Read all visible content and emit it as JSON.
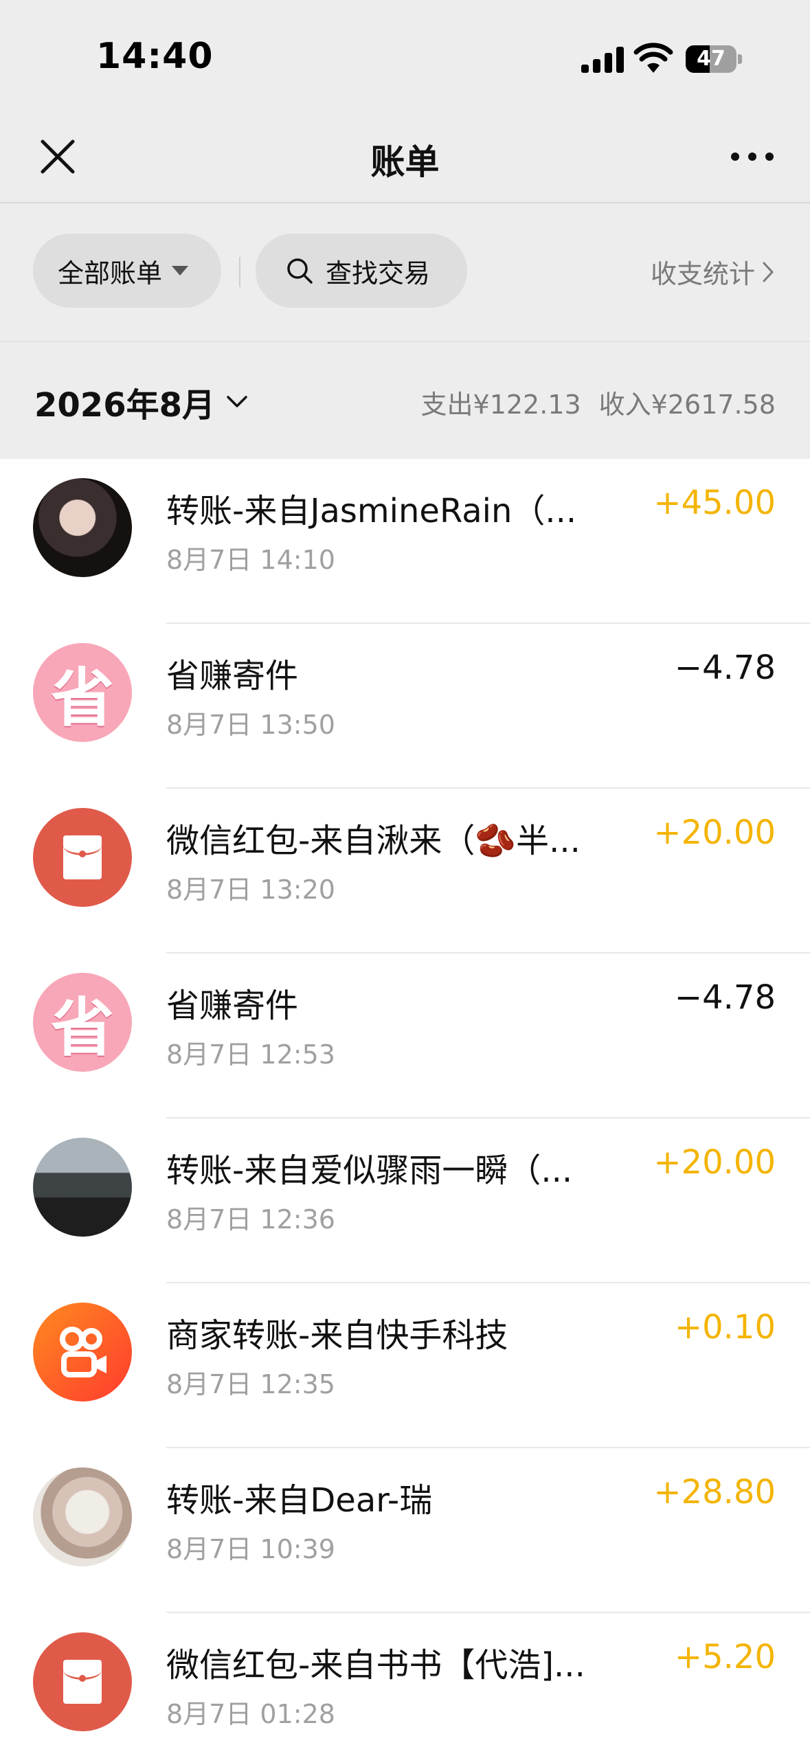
{
  "status_bar": {
    "time": "14:40",
    "battery": "47",
    "battery_level": 0.47
  },
  "nav": {
    "title": "账单",
    "close_icon": "close-icon",
    "more_icon": "more-icon"
  },
  "filters": {
    "all_bills": "全部账单",
    "search": "查找交易",
    "stats": "收支统计"
  },
  "month_header": {
    "month": "2026年8月",
    "expense": "支出¥122.13",
    "income": "收入¥2617.58"
  },
  "transactions": [
    {
      "title": "转账-来自JasmineRain（...",
      "time": "8月7日 14:10",
      "amount": "+45.00",
      "type": "income",
      "avatar": "photo"
    },
    {
      "title": "省赚寄件",
      "time": "8月7日 13:50",
      "amount": "−4.78",
      "type": "expense",
      "avatar": "sheng-logo",
      "avatar_text": "省"
    },
    {
      "title": "微信红包-来自湫来（🫘半...",
      "time": "8月7日 13:20",
      "amount": "+20.00",
      "type": "income",
      "avatar": "red-packet-icon"
    },
    {
      "title": "省赚寄件",
      "time": "8月7日 12:53",
      "amount": "−4.78",
      "type": "expense",
      "avatar": "sheng-logo",
      "avatar_text": "省"
    },
    {
      "title": "转账-来自爱似骤雨一瞬（...",
      "time": "8月7日 12:36",
      "amount": "+20.00",
      "type": "income",
      "avatar": "photo"
    },
    {
      "title": "商家转账-来自快手科技",
      "time": "8月7日 12:35",
      "amount": "+0.10",
      "type": "income",
      "avatar": "kuaishou-logo"
    },
    {
      "title": "转账-来自Dear-瑞",
      "time": "8月7日 10:39",
      "amount": "+28.80",
      "type": "income",
      "avatar": "photo"
    },
    {
      "title": "微信红包-来自书书【代浩]...",
      "time": "8月7日 01:28",
      "amount": "+5.20",
      "type": "income",
      "avatar": "red-packet-icon"
    }
  ],
  "colors": {
    "income": "#f4b400",
    "expense": "#111111",
    "red_packet": "#e05a4a",
    "sheng": "#f8a7b8"
  }
}
